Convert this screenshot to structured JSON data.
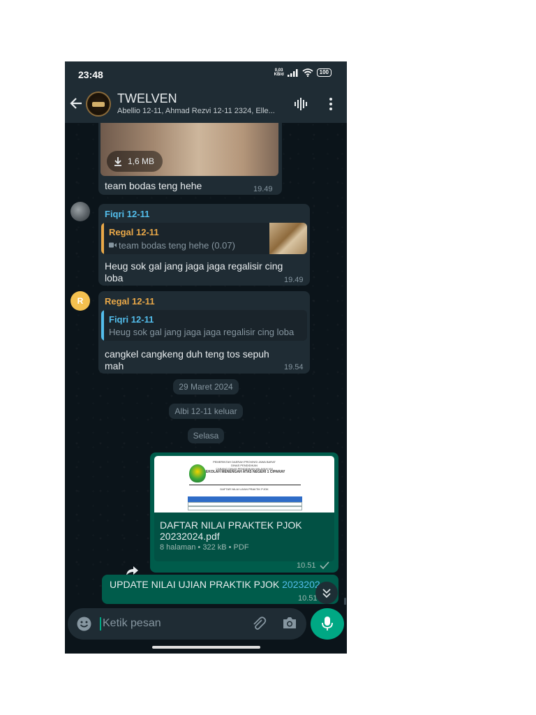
{
  "status_bar": {
    "time": "23:48",
    "speed_value": "0,03",
    "speed_unit": "KB/d",
    "battery": "100"
  },
  "header": {
    "group_name": "TWELVEN",
    "members": "Abellio 12-11, Ahmad Rezvi 12-11 2324, Elle...",
    "avatar_label": "TWELVEN"
  },
  "messages": {
    "image_msg": {
      "file_size": "1,6 MB",
      "caption": "team bodas teng hehe",
      "time": "19.49"
    },
    "fiqri_msg": {
      "sender": "Fiqri 12-11",
      "quote_sender": "Regal 12-11",
      "quote_text": "team bodas teng hehe (0.07)",
      "text_line1": "Heug sok gal jang jaga jaga regalisir cing",
      "text_line2": "loba",
      "time": "19.49"
    },
    "regal_msg": {
      "avatar_initial": "R",
      "sender": "Regal 12-11",
      "quote_sender": "Fiqri 12-11",
      "quote_text": "Heug sok gal jang jaga jaga regalisir cing loba",
      "text_line1": "cangkel cangkeng duh teng tos sepuh",
      "text_line2": "mah",
      "time": "19.54"
    },
    "date_divider": "29 Maret 2024",
    "system_left": "Albi 12-11 keluar",
    "day_divider": "Selasa",
    "pdf_msg": {
      "thumb_line1": "PEMERINTAH DAERAH PROVINSI JAWA BARAT",
      "thumb_line2": "DINAS PENDIDIKAN",
      "thumb_line3": "CABANG DINAS PENDIDIKAN WILAYAH VIII",
      "thumb_line4": "SEKOLAH MENENGAH ATAS NEGERI 1 CIPARAY",
      "thumb_title": "DAFTAR NILAI UJIAN PRAKTIK PJOK",
      "title_line1": "DAFTAR NILAI PRAKTEK PJOK",
      "title_line2": "20232024.pdf",
      "meta": "8 halaman • 322 kB • PDF",
      "time": "10.51"
    },
    "update_msg": {
      "text": "UPDATE NILAI UJIAN PRAKTIK PJOK ",
      "link": "2023202",
      "time": "10.51"
    }
  },
  "input": {
    "placeholder": "Ketik pesan"
  },
  "colors": {
    "app_bar": "#1f2c34",
    "chat_bg": "#0b141a",
    "bubble_in": "#1f2c34",
    "bubble_out": "#005c4b",
    "accent": "#00a884",
    "fiqri_name": "#53bdeb",
    "regal_name": "#e9a848"
  }
}
